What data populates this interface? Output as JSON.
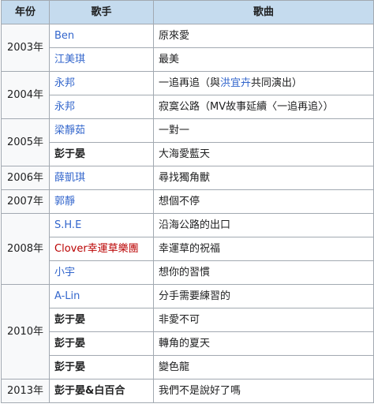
{
  "headers": {
    "year": "年份",
    "singer": "歌手",
    "song": "歌曲"
  },
  "rows": [
    {
      "year": "2003年",
      "singer": "Ben",
      "song": "原來愛"
    },
    {
      "singer": "江美琪",
      "song": "最美"
    },
    {
      "year": "2004年",
      "singer": "永邦",
      "song_parts": [
        "一追再追（與",
        "洪宜卉",
        "共同演出）"
      ]
    },
    {
      "singer": "永邦",
      "song": "寂寞公路（MV故事延續〈一追再追〉）"
    },
    {
      "year": "2005年",
      "singer": "梁靜茹",
      "song": "一對一"
    },
    {
      "singer": "彭于晏",
      "song": "大海愛藍天"
    },
    {
      "year": "2006年",
      "singer": "薛凱琪",
      "song": "尋找獨角獸"
    },
    {
      "year": "2007年",
      "singer": "郭靜",
      "song": "想個不停"
    },
    {
      "year": "2008年",
      "singer": "S.H.E",
      "song": "沿海公路的出口"
    },
    {
      "singer": "Clover幸運草樂團",
      "song": "幸運草的祝福"
    },
    {
      "singer": "小宇",
      "song": "想你的習慣"
    },
    {
      "year": "2010年",
      "singer": "A-Lin",
      "song": "分手需要練習的"
    },
    {
      "singer": "彭于晏",
      "song": "非愛不可"
    },
    {
      "singer": "彭于晏",
      "song": "轉角的夏天"
    },
    {
      "singer": "彭于晏",
      "song": "變色龍"
    },
    {
      "year": "2013年",
      "singer": "彭于晏&白百合",
      "song": "我們不是說好了嗎"
    }
  ],
  "colors": {
    "header_bg": "#c5dbee",
    "year_bg": "#f8f9fa",
    "link": "#3366cc",
    "red_link": "#ba0000",
    "border": "#a2a9b1"
  }
}
